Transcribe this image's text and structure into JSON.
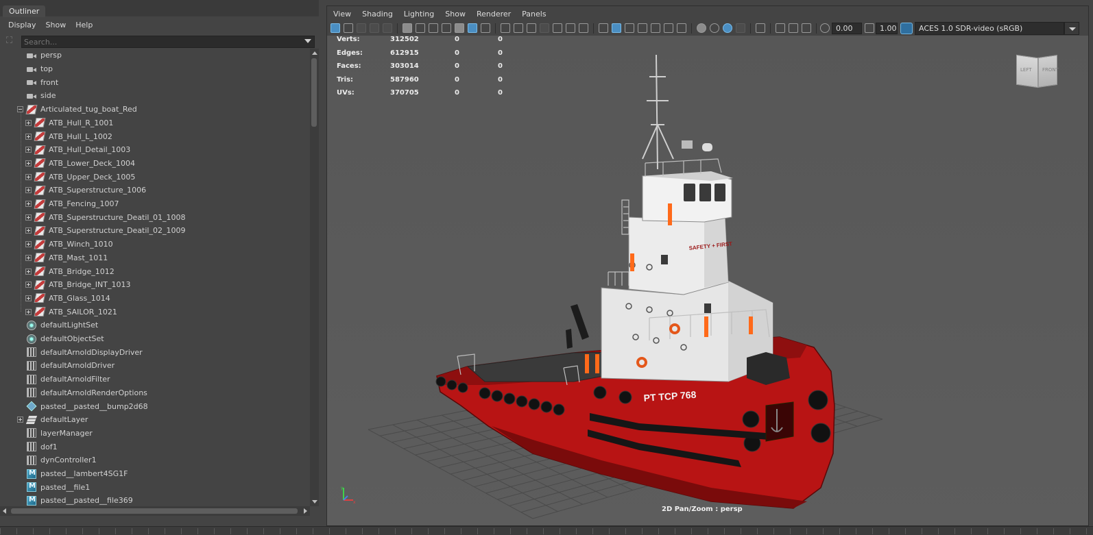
{
  "outliner": {
    "tab": "Outliner",
    "menu": [
      "Display",
      "Show",
      "Help"
    ],
    "search_placeholder": "Search...",
    "items": [
      {
        "label": "persp",
        "icon": "camera",
        "depth": 0,
        "expander": "none"
      },
      {
        "label": "top",
        "icon": "camera",
        "depth": 0,
        "expander": "none"
      },
      {
        "label": "front",
        "icon": "camera",
        "depth": 0,
        "expander": "none"
      },
      {
        "label": "side",
        "icon": "camera",
        "depth": 0,
        "expander": "none"
      },
      {
        "label": "Articulated_tug_boat_Red",
        "icon": "mesh",
        "depth": 0,
        "expander": "minus"
      },
      {
        "label": "ATB_Hull_R_1001",
        "icon": "mesh",
        "depth": 1,
        "expander": "plus"
      },
      {
        "label": "ATB_Hull_L_1002",
        "icon": "mesh",
        "depth": 1,
        "expander": "plus"
      },
      {
        "label": "ATB_Hull_Detail_1003",
        "icon": "mesh",
        "depth": 1,
        "expander": "plus"
      },
      {
        "label": "ATB_Lower_Deck_1004",
        "icon": "mesh",
        "depth": 1,
        "expander": "plus"
      },
      {
        "label": "ATB_Upper_Deck_1005",
        "icon": "mesh",
        "depth": 1,
        "expander": "plus"
      },
      {
        "label": "ATB_Superstructure_1006",
        "icon": "mesh",
        "depth": 1,
        "expander": "plus"
      },
      {
        "label": "ATB_Fencing_1007",
        "icon": "mesh",
        "depth": 1,
        "expander": "plus"
      },
      {
        "label": "ATB_Superstructure_Deatil_01_1008",
        "icon": "mesh",
        "depth": 1,
        "expander": "plus"
      },
      {
        "label": "ATB_Superstructure_Deatil_02_1009",
        "icon": "mesh",
        "depth": 1,
        "expander": "plus"
      },
      {
        "label": "ATB_Winch_1010",
        "icon": "mesh",
        "depth": 1,
        "expander": "plus"
      },
      {
        "label": "ATB_Mast_1011",
        "icon": "mesh",
        "depth": 1,
        "expander": "plus"
      },
      {
        "label": "ATB_Bridge_1012",
        "icon": "mesh",
        "depth": 1,
        "expander": "plus"
      },
      {
        "label": "ATB_Bridge_INT_1013",
        "icon": "mesh",
        "depth": 1,
        "expander": "plus"
      },
      {
        "label": "ATB_Glass_1014",
        "icon": "mesh",
        "depth": 1,
        "expander": "plus"
      },
      {
        "label": "ATB_SAILOR_1021",
        "icon": "mesh",
        "depth": 1,
        "expander": "plus"
      },
      {
        "label": "defaultLightSet",
        "icon": "lightset",
        "depth": 0,
        "expander": "none"
      },
      {
        "label": "defaultObjectSet",
        "icon": "lightset",
        "depth": 0,
        "expander": "none"
      },
      {
        "label": "defaultArnoldDisplayDriver",
        "icon": "node",
        "depth": 0,
        "expander": "none"
      },
      {
        "label": "defaultArnoldDriver",
        "icon": "node",
        "depth": 0,
        "expander": "none"
      },
      {
        "label": "defaultArnoldFilter",
        "icon": "node",
        "depth": 0,
        "expander": "none"
      },
      {
        "label": "defaultArnoldRenderOptions",
        "icon": "node",
        "depth": 0,
        "expander": "none"
      },
      {
        "label": "pasted__pasted__bump2d68",
        "icon": "bump",
        "depth": 0,
        "expander": "none"
      },
      {
        "label": "defaultLayer",
        "icon": "layer",
        "depth": 0,
        "expander": "plus"
      },
      {
        "label": "layerManager",
        "icon": "node",
        "depth": 0,
        "expander": "none"
      },
      {
        "label": "dof1",
        "icon": "node",
        "depth": 0,
        "expander": "none"
      },
      {
        "label": "dynController1",
        "icon": "node",
        "depth": 0,
        "expander": "none"
      },
      {
        "label": "pasted__lambert4SG1F",
        "icon": "shader",
        "depth": 0,
        "expander": "none"
      },
      {
        "label": "pasted__file1",
        "icon": "shader",
        "depth": 0,
        "expander": "none"
      },
      {
        "label": "pasted__pasted__file369",
        "icon": "shader",
        "depth": 0,
        "expander": "none"
      }
    ]
  },
  "viewport": {
    "menu": [
      "View",
      "Shading",
      "Lighting",
      "Show",
      "Renderer",
      "Panels"
    ],
    "exposure": "0.00",
    "gamma": "1.00",
    "color_space": "ACES 1.0 SDR-video (sRGB)",
    "camera_label": "2D Pan/Zoom : persp",
    "viewcube": {
      "left": "LEFT",
      "front": "FRONT"
    },
    "stats": [
      {
        "label": "Verts:",
        "total": "312502",
        "selected": "0",
        "components": "0"
      },
      {
        "label": "Edges:",
        "total": "612915",
        "selected": "0",
        "components": "0"
      },
      {
        "label": "Faces:",
        "total": "303014",
        "selected": "0",
        "components": "0"
      },
      {
        "label": "Tris:",
        "total": "587960",
        "selected": "0",
        "components": "0"
      },
      {
        "label": "UVs:",
        "total": "370705",
        "selected": "0",
        "components": "0"
      }
    ],
    "boat": {
      "hull_name": "PT TCP 768",
      "sign": "SAFETY + FIRST",
      "hull_color": "#b81414",
      "superstructure_color": "#e6e6e6"
    }
  },
  "colors": {
    "panel_bg": "#444444",
    "viewport_bg": "#5a5a5a",
    "accent": "#4a8ec2"
  }
}
